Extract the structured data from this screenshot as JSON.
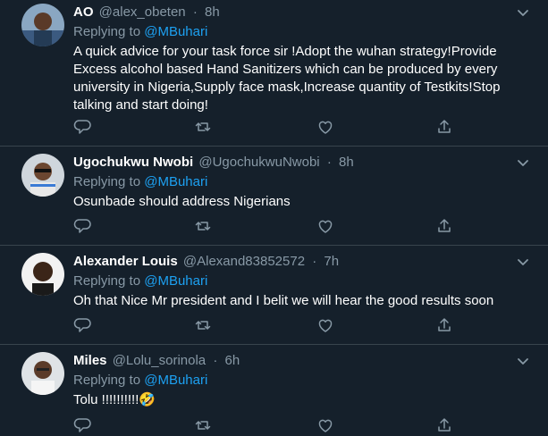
{
  "reply_prefix": "Replying to",
  "tweets": [
    {
      "name": "AO",
      "handle": "@alex_obeten",
      "separator": "·",
      "time": "8h",
      "reply_to": "@MBuhari",
      "text": "A quick advice for your task force sir !Adopt the wuhan strategy!Provide Excess alcohol based Hand Sanitizers which can be produced by every university in Nigeria,Supply face mask,Increase quantity of Testkits!Stop talking and start doing!"
    },
    {
      "name": "Ugochukwu Nwobi",
      "handle": "@UgochukwuNwobi",
      "separator": "·",
      "time": "8h",
      "reply_to": "@MBuhari",
      "text": "Osunbade should address Nigerians"
    },
    {
      "name": "Alexander Louis",
      "handle": "@Alexand83852572",
      "separator": "·",
      "time": "7h",
      "reply_to": "@MBuhari",
      "text": "Oh that Nice Mr president and I belit we will hear the good results soon"
    },
    {
      "name": "Miles",
      "handle": "@Lolu_sorinola",
      "separator": "·",
      "time": "6h",
      "reply_to": "@MBuhari",
      "text": "Tolu !!!!!!!!!!🤣"
    }
  ],
  "icons": {
    "reply": "reply-icon",
    "retweet": "retweet-icon",
    "like": "heart-icon",
    "share": "share-icon",
    "more": "chevron-down-icon"
  },
  "colors": {
    "background": "#15202b",
    "border": "#38444d",
    "secondary_text": "#8899a6",
    "primary_text": "#ffffff",
    "accent": "#1da1f2"
  }
}
